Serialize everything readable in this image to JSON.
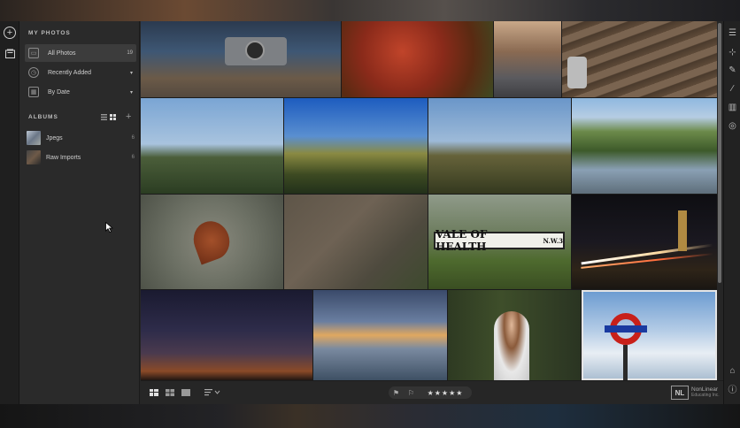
{
  "sidebar": {
    "my_photos_title": "MY PHOTOS",
    "items": [
      {
        "label": "All Photos",
        "count": "19"
      },
      {
        "label": "Recently Added",
        "count": "▾"
      },
      {
        "label": "By Date",
        "count": "▾"
      }
    ],
    "albums_title": "ALBUMS",
    "albums": [
      {
        "label": "Jpegs",
        "count": "6"
      },
      {
        "label": "Raw Imports",
        "count": "6"
      }
    ]
  },
  "toolbar": {
    "stars": "★★★★★"
  },
  "watermark": {
    "logo": "NL",
    "line1": "NonLinear",
    "line2": "Educating Inc."
  },
  "signboard": {
    "text": "VALE OF HEALTH",
    "sub": "N.W.3"
  },
  "colors": {
    "app_bg": "#262626",
    "sidebar_bg": "#2a2a2a",
    "selection": "#e5e5e5"
  }
}
